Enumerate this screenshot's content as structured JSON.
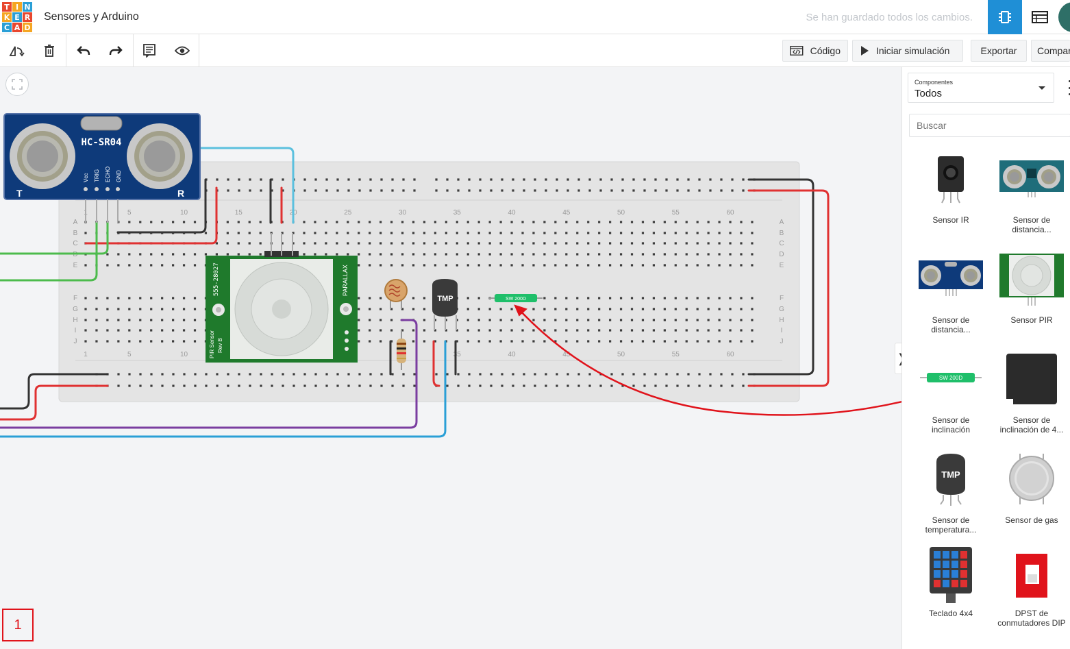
{
  "header": {
    "logo_letters": [
      "T",
      "I",
      "N",
      "K",
      "E",
      "R",
      "C",
      "A",
      "D"
    ],
    "logo_colors": [
      "#e8472e",
      "#f5a623",
      "#2a9fd6",
      "#f5a623",
      "#2a9fd6",
      "#e8472e",
      "#2a9fd6",
      "#e8472e",
      "#f5a623"
    ],
    "title": "Sensores y Arduino",
    "save_status": "Se han guardado todos los cambios.",
    "accent": "#1f8fd6"
  },
  "toolbar": {
    "icons": [
      "rotate-icon",
      "trash-icon",
      "undo-icon",
      "redo-icon",
      "notes-icon",
      "visibility-icon"
    ],
    "code_label": "Código",
    "simulate_label": "Iniciar simulación",
    "export_label": "Exportar",
    "share_label": "Compartir"
  },
  "canvas": {
    "page_number": "1",
    "breadboard": {
      "row_labels_top": [
        "A",
        "B",
        "C",
        "D",
        "E"
      ],
      "row_labels_bottom": [
        "F",
        "G",
        "H",
        "I",
        "J"
      ],
      "col_numbers": [
        "1",
        "5",
        "10",
        "15",
        "20",
        "25",
        "30",
        "35",
        "40",
        "45",
        "50",
        "55",
        "60"
      ]
    },
    "ultrasonic": {
      "model": "HC-SR04",
      "pins": [
        "Vcc",
        "TRIG",
        "ECHO",
        "GND"
      ],
      "left_mark": "T",
      "right_mark": "R"
    },
    "pir": {
      "left_text": "PIR Sensor",
      "left_text2": "Rev B",
      "part_no": "555-28027",
      "right_text": "PARALLAX"
    },
    "tmp_label": "TMP",
    "tilt_label": "SW 200D"
  },
  "sidebar": {
    "components_label": "Componentes",
    "components_value": "Todos",
    "search_placeholder": "Buscar",
    "items": [
      {
        "name": "Sensor IR",
        "icon": "ir-sensor-icon"
      },
      {
        "name": "Sensor de distancia...",
        "icon": "ping-sensor-icon"
      },
      {
        "name": "Sensor de distancia...",
        "icon": "ultrasonic-sensor-icon"
      },
      {
        "name": "Sensor PIR",
        "icon": "pir-sensor-icon"
      },
      {
        "name": "Sensor de inclinación",
        "icon": "tilt-sensor-icon"
      },
      {
        "name": "Sensor de inclinación de 4...",
        "icon": "tilt4-sensor-icon"
      },
      {
        "name": "Sensor de temperatura...",
        "icon": "temperature-sensor-icon"
      },
      {
        "name": "Sensor de gas",
        "icon": "gas-sensor-icon"
      },
      {
        "name": "Teclado 4x4",
        "icon": "keypad-icon"
      },
      {
        "name": "DPST de conmutadores DIP",
        "icon": "dip-switch-icon"
      }
    ],
    "thumb_tilt_label": "SW 200D",
    "thumb_tmp_label": "TMP"
  }
}
